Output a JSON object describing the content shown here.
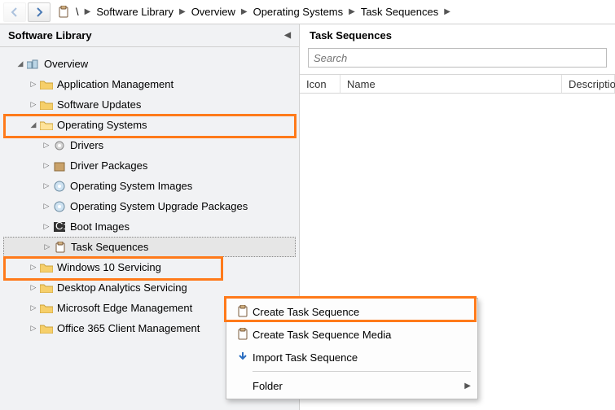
{
  "breadcrumb": {
    "root": "\\",
    "items": [
      "Software Library",
      "Overview",
      "Operating Systems",
      "Task Sequences"
    ]
  },
  "sidebar": {
    "title": "Software Library",
    "root": "Overview",
    "nodes": {
      "appmgmt": "Application Management",
      "updates": "Software Updates",
      "os": "Operating Systems",
      "drivers": "Drivers",
      "drvpkg": "Driver Packages",
      "osimg": "Operating System Images",
      "osupg": "Operating System Upgrade Packages",
      "boot": "Boot Images",
      "taskseq": "Task Sequences",
      "win10": "Windows 10 Servicing",
      "desk": "Desktop Analytics Servicing",
      "edge": "Microsoft Edge Management",
      "o365": "Office 365 Client Management"
    }
  },
  "right": {
    "title": "Task Sequences",
    "search_placeholder": "Search",
    "columns": {
      "icon": "Icon",
      "name": "Name",
      "desc": "Description"
    }
  },
  "contextmenu": {
    "create": "Create Task Sequence",
    "media": "Create Task Sequence Media",
    "import": "Import Task Sequence",
    "folder": "Folder"
  }
}
